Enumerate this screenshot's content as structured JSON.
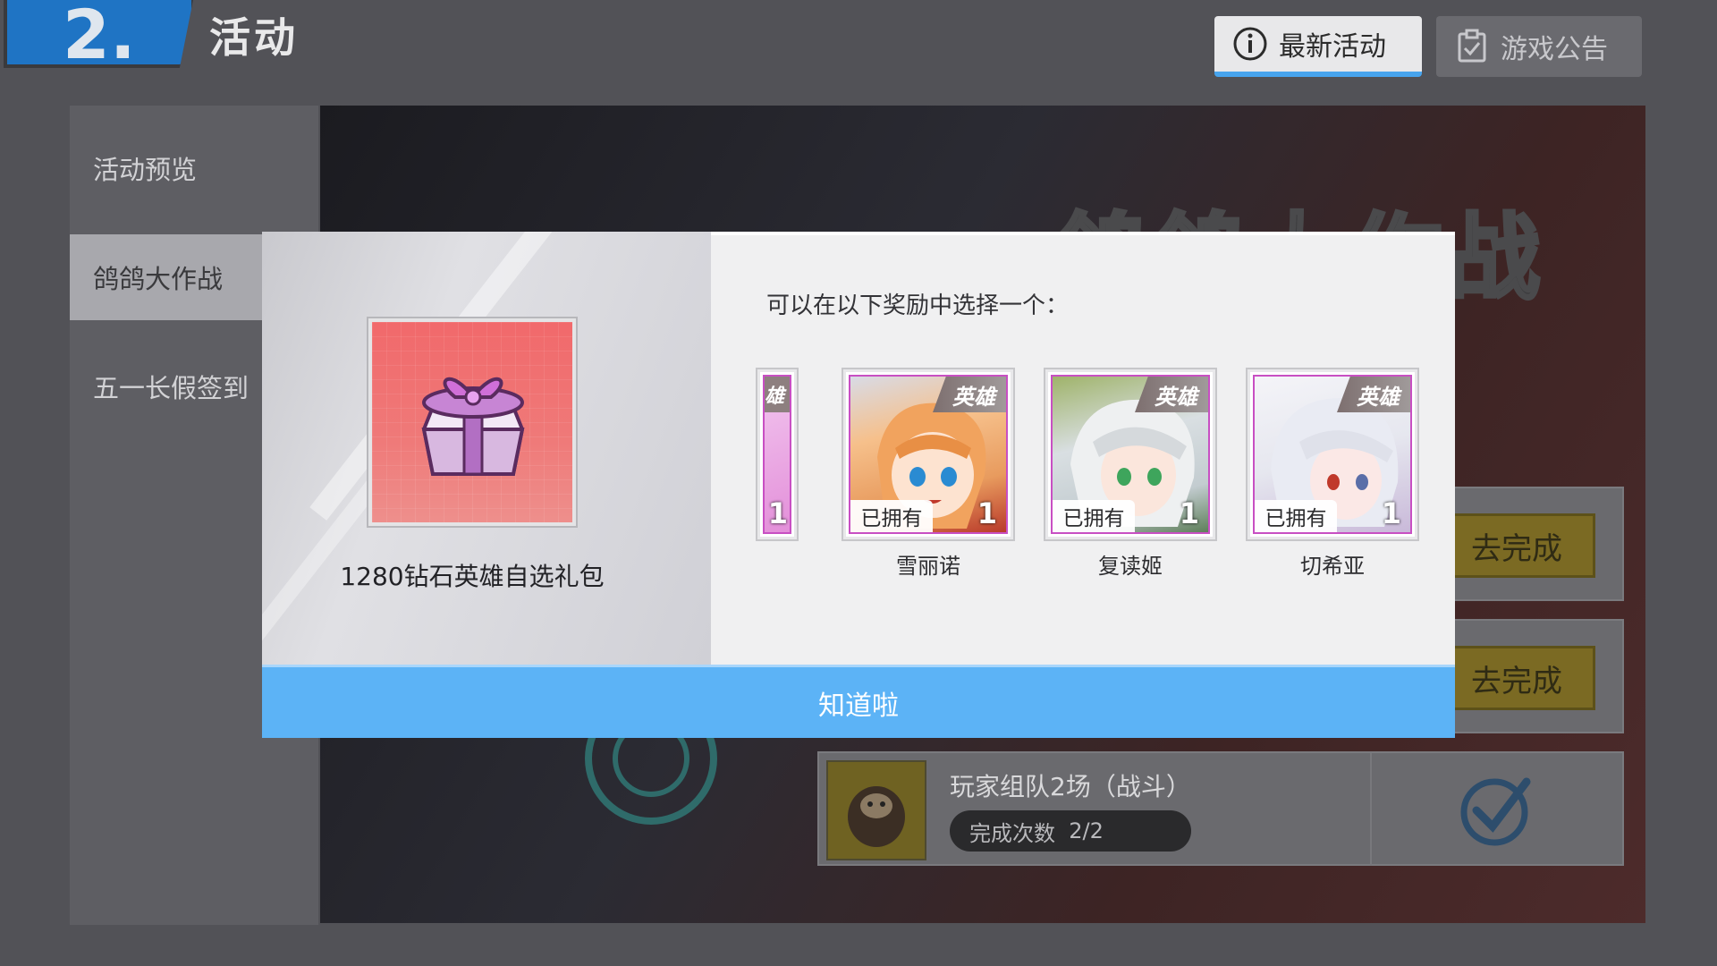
{
  "header": {
    "logo_number": "2.",
    "title": "活动",
    "tabs": [
      {
        "label": "最新活动",
        "icon": "info-icon"
      },
      {
        "label": "游戏公告",
        "icon": "clipboard-check-icon"
      }
    ]
  },
  "sidebar": {
    "items": [
      {
        "label": "活动预览"
      },
      {
        "label": "鸽鸽大作战"
      },
      {
        "label": "五一长假签到"
      }
    ]
  },
  "banner": {
    "title": "鸽鸽大作战"
  },
  "tasks": [
    {
      "button_label": "去完成"
    },
    {
      "button_label": "去完成"
    },
    {
      "name": "玩家组队2场（战斗）",
      "progress_label": "完成次数",
      "progress_value": "2/2",
      "completed": true
    }
  ],
  "modal": {
    "gift_name": "1280钻石英雄自选礼包",
    "prompt": "可以在以下奖励中选择一个：",
    "heroes": [
      {
        "name": "",
        "tag": "雄",
        "count": "1",
        "partial": true
      },
      {
        "name": "雪丽诺",
        "tag": "英雄",
        "owned_label": "已拥有",
        "count": "1",
        "colors": [
          "#f2b27a",
          "#c7452e"
        ]
      },
      {
        "name": "复读姬",
        "tag": "英雄",
        "owned_label": "已拥有",
        "count": "1",
        "colors": [
          "#dfe4e6",
          "#4fa36b"
        ]
      },
      {
        "name": "切希亚",
        "tag": "英雄",
        "owned_label": "已拥有",
        "count": "1",
        "colors": [
          "#eef0f6",
          "#c05fc3"
        ]
      }
    ],
    "confirm_label": "知道啦"
  }
}
